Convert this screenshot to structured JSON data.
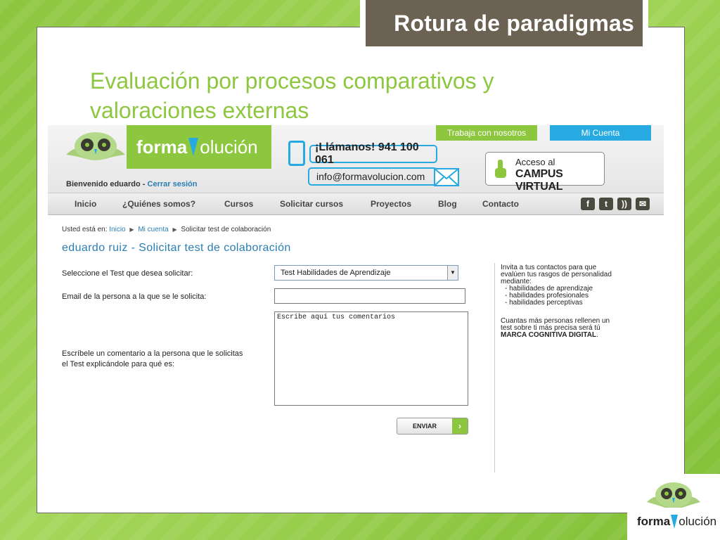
{
  "slide": {
    "title": "Rotura de paradigmas",
    "subtitle_line1": "Evaluación por procesos comparativos y",
    "subtitle_line2": "valoraciones externas"
  },
  "site": {
    "logo_forma": "forma",
    "logo_olucion": "olución",
    "welcome_text": "Bienvenido eduardo",
    "welcome_sep": " - ",
    "logout_label": "Cerrar sesión",
    "phone_text": "¡Llámanos!  941 100 061",
    "email_text": "info@formavolucion.com",
    "work_label": "Trabaja con nosotros",
    "account_label": "Mi Cuenta",
    "campus_line1": "Acceso al",
    "campus_line2": "CAMPUS VIRTUAL",
    "nav": [
      "Inicio",
      "¿Quiénes somos?",
      "Cursos",
      "Solicitar cursos",
      "Proyectos",
      "Blog",
      "Contacto"
    ],
    "social_icons": [
      "facebook-icon",
      "twitter-icon",
      "rss-icon",
      "mail-icon"
    ],
    "breadcrumb": {
      "prefix": "Usted está en:",
      "items": [
        "Inicio",
        "Mi cuenta",
        "Solicitar test de colaboración"
      ]
    },
    "page_title": "eduardo ruiz - Solicitar test de colaboración",
    "form": {
      "select_label": "Seleccione el Test que desea solicitar:",
      "select_value": "Test Habilidades de Aprendizaje",
      "email_label": "Email de la persona a la que se le solicita:",
      "email_value": "",
      "comment_label_1": "Escríbele un comentario a la persona que le solicitas",
      "comment_label_2": "el Test explicándole para qué es:",
      "comment_value": "Escribe aquí tus comentarios",
      "send_label": "ENVIAR"
    },
    "sidebar": {
      "intro_1": "Invita a tus contactos para que",
      "intro_2": "evalúen tus rasgos de personalidad",
      "intro_3": "mediante:",
      "bullets": [
        "- habilidades de aprendizaje",
        "- habilidades profesionales",
        "- habilidades perceptivas"
      ],
      "outro_1": "Cuantas más personas rellenen un",
      "outro_2": "test sobre ti más precisa será tú",
      "outro_bold": "MARCA COGNITIVA DIGITAL",
      "outro_end": "."
    }
  },
  "corner_logo": {
    "forma": "forma",
    "olucion": "olución"
  },
  "colors": {
    "brand_green": "#8dc63f",
    "brand_blue": "#27a9e1",
    "title_bg": "#6c6253"
  }
}
